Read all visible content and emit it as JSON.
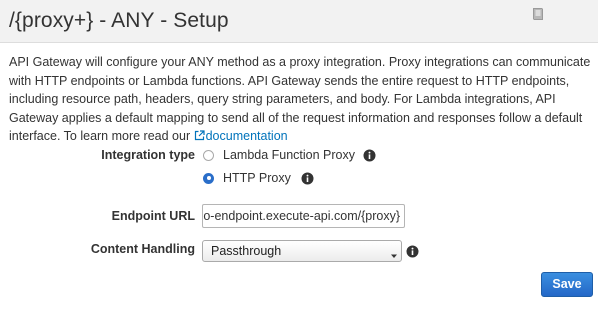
{
  "header": {
    "title": "/{proxy+} - ANY - Setup",
    "icon": "book-icon"
  },
  "intro": {
    "text": "API Gateway will configure your ANY method as a proxy integration. Proxy integrations can communicate with HTTP endpoints or Lambda functions. API Gateway sends the entire request to HTTP endpoints, including resource path, headers, query string parameters, and body. For Lambda integrations, API Gateway applies a default mapping to send all of the request information and responses follow a default interface. To learn more read our ",
    "link_icon": "external-link-icon",
    "link_label": "documentation"
  },
  "integration": {
    "label": "Integration type",
    "options": [
      {
        "label": "Lambda Function Proxy",
        "selected": false
      },
      {
        "label": "HTTP Proxy",
        "selected": true
      }
    ],
    "info_icon": "info-icon"
  },
  "endpoint": {
    "label": "Endpoint URL",
    "value": "emo-endpoint.execute-api.com/{proxy}"
  },
  "content_handling": {
    "label": "Content Handling",
    "selected": "Passthrough",
    "info_icon": "info-icon"
  },
  "actions": {
    "save_label": "Save"
  },
  "colors": {
    "accent": "#2a6ec9",
    "link": "#0073bb",
    "header_bg": "#f2f2f2",
    "text": "#333333"
  }
}
